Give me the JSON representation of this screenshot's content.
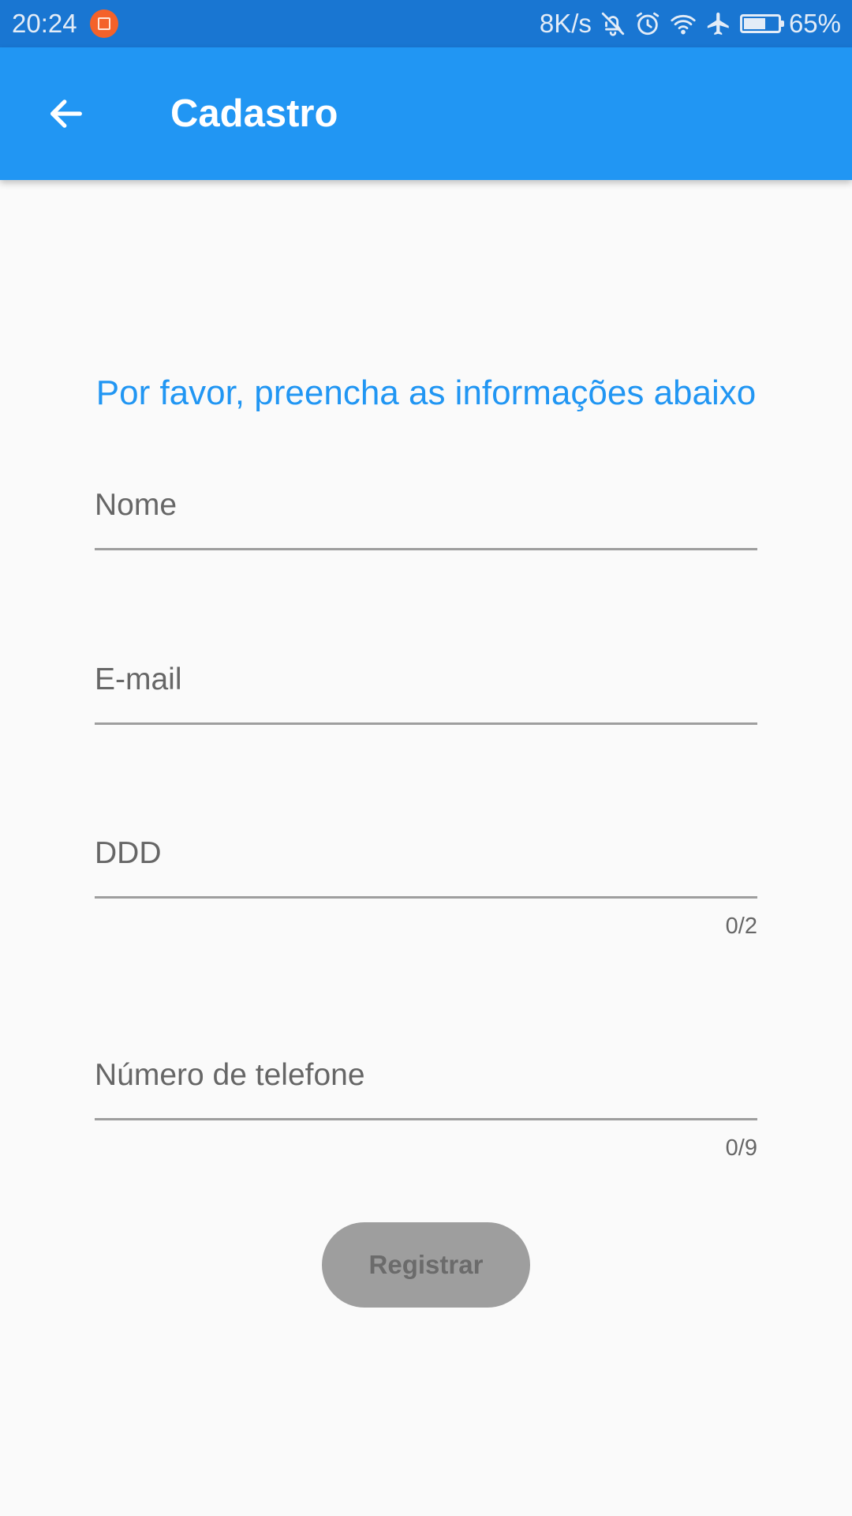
{
  "status_bar": {
    "time": "20:24",
    "network_speed": "8K/s",
    "battery_percent": "65%",
    "battery_level": 0.65,
    "icons": [
      "app-notification-icon",
      "bell-off-icon",
      "alarm-icon",
      "wifi-icon",
      "airplane-icon",
      "battery-icon"
    ]
  },
  "app_bar": {
    "back_icon": "arrow-left-icon",
    "title": "Cadastro",
    "color": "#2196f3"
  },
  "form": {
    "instruction": "Por favor, preencha as informações abaixo",
    "fields": {
      "name": {
        "label": "Nome",
        "value": ""
      },
      "email": {
        "label": "E-mail",
        "value": ""
      },
      "ddd": {
        "label": "DDD",
        "value": "",
        "counter": "0/2"
      },
      "phone": {
        "label": "Número de telefone",
        "value": "",
        "counter": "0/9"
      }
    },
    "register_label": "Registrar"
  },
  "colors": {
    "accent": "#2196f3",
    "status_bar": "#1976d2",
    "disabled_button": "#9e9e9e",
    "label_text": "#666666",
    "background": "#fafafa"
  }
}
